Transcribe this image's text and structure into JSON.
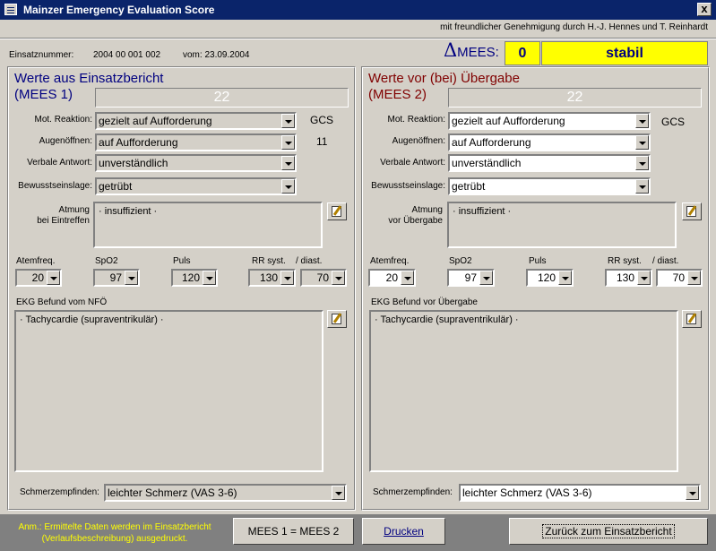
{
  "window": {
    "title": "Mainzer Emergency Evaluation Score",
    "close": "x"
  },
  "credit": "mit freundlicher Genehmigung durch H.-J. Hennes und T. Reinhardt",
  "case": {
    "number_label": "Einsatznummer:",
    "number": "2004 00 001  002",
    "date": "vom: 23.09.2004"
  },
  "mees_delta": {
    "label": "MEES:",
    "value": "0",
    "status": "stabil",
    "colors": {
      "box": "#ffff00",
      "text": "#000080"
    }
  },
  "left": {
    "title_line1": "Werte aus Einsatzbericht",
    "title_line2": "(MEES 1)",
    "score": "22",
    "fields": [
      {
        "label": "Mot. Reaktion:",
        "value": "gezielt auf Aufforderung"
      },
      {
        "label": "Augenöffnen:",
        "value": "auf Aufforderung"
      },
      {
        "label": "Verbale Antwort:",
        "value": "unverständlich"
      },
      {
        "label": "Bewusstseinslage:",
        "value": "getrübt"
      }
    ],
    "gcs_label": "GCS",
    "gcs_value": "11",
    "atmung_label1": "Atmung",
    "atmung_label2": "bei Eintreffen",
    "atmung_value": "· insuffizient ·",
    "vitals_labels": [
      "Atemfreq.",
      "SpO2",
      "Puls",
      "RR syst.",
      "/  diast."
    ],
    "vitals_values": [
      "20",
      "97",
      "120",
      "130",
      "70"
    ],
    "ekg_label": "EKG Befund vom NFÖ",
    "ekg_value": "· Tachycardie (supraventrikulär) ·",
    "pain_label": "Schmerzempfinden:",
    "pain_value": "leichter Schmerz (VAS 3-6)"
  },
  "right": {
    "title_line1": "Werte vor (bei) Übergabe",
    "title_line2": "(MEES 2)",
    "score": "22",
    "fields": [
      {
        "label": "Mot. Reaktion:",
        "value": "gezielt auf Aufforderung"
      },
      {
        "label": "Augenöffnen:",
        "value": "auf Aufforderung"
      },
      {
        "label": "Verbale Antwort:",
        "value": "unverständlich"
      },
      {
        "label": "Bewusstseinslage:",
        "value": "getrübt"
      }
    ],
    "gcs_label": "GCS",
    "atmung_label1": "Atmung",
    "atmung_label2": "vor Übergabe",
    "atmung_value": "· insuffizient ·",
    "vitals_labels": [
      "Atemfreq.",
      "SpO2",
      "Puls",
      "RR syst.",
      "/ diast."
    ],
    "vitals_values": [
      "20",
      "97",
      "120",
      "130",
      "70"
    ],
    "ekg_label": "EKG Befund vor Übergabe",
    "ekg_value": "· Tachycardie (supraventrikulär) ·",
    "pain_label": "Schmerzempfinden:",
    "pain_value": "leichter Schmerz (VAS 3-6)"
  },
  "footer": {
    "note_line1": "Anm.:  Ermittelte Daten werden im Einsatzbericht",
    "note_line2": "(Verlaufsbeschreibung) ausgedruckt.",
    "btn_copy": "MEES 1 = MEES 2",
    "btn_print": "Drucken",
    "btn_back": "Zurück zum Einsatzbericht"
  }
}
